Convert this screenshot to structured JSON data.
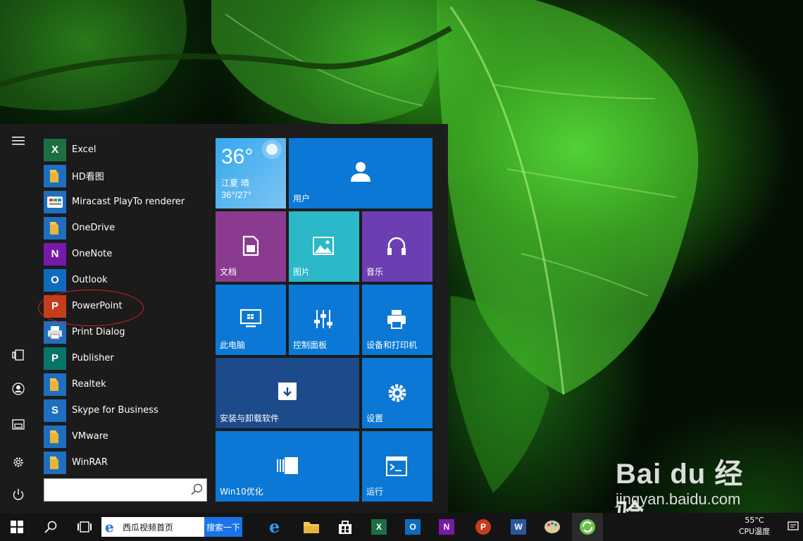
{
  "start_menu": {
    "apps": [
      {
        "label": "Excel",
        "icon": "excel-icon",
        "color": "#1d6f42",
        "glyph": "X"
      },
      {
        "label": "HD看图",
        "icon": "folder-icon",
        "color": "#1e6fc0",
        "glyph": ""
      },
      {
        "label": "Miracast PlayTo renderer",
        "icon": "miracast-icon",
        "color": "#1e6fc0",
        "glyph": ""
      },
      {
        "label": "OneDrive",
        "icon": "folder-icon",
        "color": "#1e6fc0",
        "glyph": ""
      },
      {
        "label": "OneNote",
        "icon": "onenote-icon",
        "color": "#7719aa",
        "glyph": "N"
      },
      {
        "label": "Outlook",
        "icon": "outlook-icon",
        "color": "#0f6cbd",
        "glyph": "O"
      },
      {
        "label": "PowerPoint",
        "icon": "powerpoint-icon",
        "color": "#c43e1c",
        "glyph": "P"
      },
      {
        "label": "Print Dialog",
        "icon": "printer-icon",
        "color": "#1e6fc0",
        "glyph": ""
      },
      {
        "label": "Publisher",
        "icon": "publisher-icon",
        "color": "#077568",
        "glyph": "P"
      },
      {
        "label": "Realtek",
        "icon": "folder-icon",
        "color": "#1e6fc0",
        "glyph": ""
      },
      {
        "label": "Skype for Business",
        "icon": "skype-icon",
        "color": "#1e6fc0",
        "glyph": "S"
      },
      {
        "label": "VMware",
        "icon": "folder-icon",
        "color": "#1e6fc0",
        "glyph": ""
      },
      {
        "label": "WinRAR",
        "icon": "folder-icon",
        "color": "#1e6fc0",
        "glyph": ""
      }
    ],
    "search_placeholder": "",
    "tiles": {
      "weather": {
        "temp": "36°",
        "location": "江夏 晴",
        "range": "36°/27°"
      },
      "user": "用户",
      "documents": "文档",
      "pictures": "图片",
      "music": "音乐",
      "this_pc": "此电脑",
      "control_panel": "控制面板",
      "devices_printers": "设备和打印机",
      "install_uninstall": "安装与卸载软件",
      "settings": "设置",
      "win10_optimize": "Win10优化",
      "run": "运行"
    }
  },
  "taskbar": {
    "search_text": "西瓜视频首页",
    "search_button": "搜索一下",
    "cpu_temp": "55°C",
    "cpu_label": "CPU温度"
  },
  "watermark": {
    "logo": "Bai du 经验",
    "url": "jingyan.baidu.com"
  },
  "colors": {
    "tile_blue": "#0a78d4",
    "tile_purple_doc": "#8a3b8f",
    "tile_teal": "#2bb8c8",
    "tile_purple_music": "#6b3fb2",
    "tile_navy": "#1c4a8a",
    "highlight": "#d4232b"
  }
}
